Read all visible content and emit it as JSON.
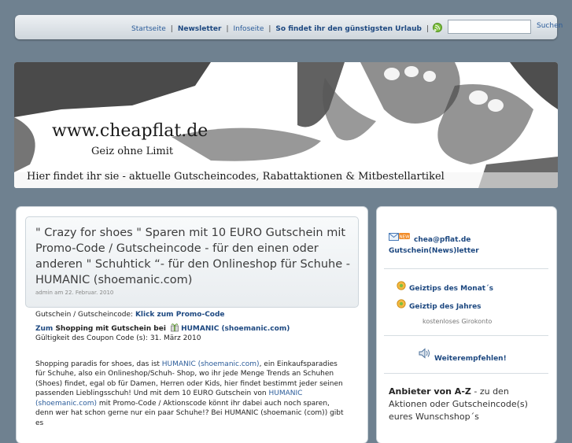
{
  "nav": {
    "items": [
      {
        "label": "Startseite",
        "bold": false
      },
      {
        "label": "Newsletter",
        "bold": true
      },
      {
        "label": "Infoseite",
        "bold": false
      },
      {
        "label": "So findet ihr den günstigsten Urlaub",
        "bold": true
      }
    ],
    "search_placeholder": "",
    "search_button": "Suchen"
  },
  "banner": {
    "title": "www.cheapflat.de",
    "tagline": "Geiz ohne Limit",
    "description": "Hier findet ihr sie - aktuelle Gutscheincodes, Rabattaktionen & Mitbestellartikel"
  },
  "post": {
    "title": "\" Crazy for shoes \" Sparen mit 10 EURO Gutschein mit Promo-Code / Gutscheincode - für den einen oder anderen \" Schuhtick “- für den Onlineshop für Schuhe - HUMANIC (shoemanic.com)",
    "meta": "admin am 22. Februar. 2010",
    "line1_prefix": "Gutschein / Gutscheincode: ",
    "line1_link": "Klick zum Promo-Code",
    "line2_link": "Zum",
    "line2_bold": " Shopping mit Gutschein bei ",
    "line2_shop": "HUMANIC (shoemanic.com)",
    "validity": "Gültigkeit des Coupon Code (s): 31. März 2010",
    "para_1": "Shopping paradis for shoes, das ist ",
    "para_link1": "HUMANIC (shoemanic.com)",
    "para_2": ", ein Einkaufsparadies für Schuhe, also ein Onlineshop/Schuh- Shop, wo ihr jede Menge Trends an Schuhen (Shoes) findet, egal ob für Damen, Herren oder Kids, hier findet bestimmt jeder seinen passenden Lieblingsschuh! Und mit dem 10 EURO Gutschein von ",
    "para_link2": "HUMANIC (shoemanic.com)",
    "para_3": " mit Promo-Code / Aktionscode könnt ihr dabei auch noch sparen, denn wer hat schon gerne nur ein paar Schuhe!? Bei HUMANIC (shoemanic (com)) gibt es"
  },
  "sidebar": {
    "email": "chea@pflat.de",
    "newsletter": "Gutschein(News)letter",
    "geiztips_month": "Geiztips des Monat´s",
    "geiztip_year": "Geiztip des Jahres",
    "girokonto": "kostenloses Girokonto",
    "recommend": "Weiterempfehlen!",
    "anbieter_bold": "Anbieter von A-Z",
    "anbieter_text": " - zu den Aktionen oder Gutscheincode(s) eures Wunschshop´s"
  },
  "colors": {
    "background": "#6f8190",
    "link": "#2b5c9a",
    "link_bold": "#1d4880"
  },
  "icons": [
    "rss-icon",
    "gift-icon",
    "email-new-icon",
    "star-badge-icon",
    "speaker-icon"
  ]
}
